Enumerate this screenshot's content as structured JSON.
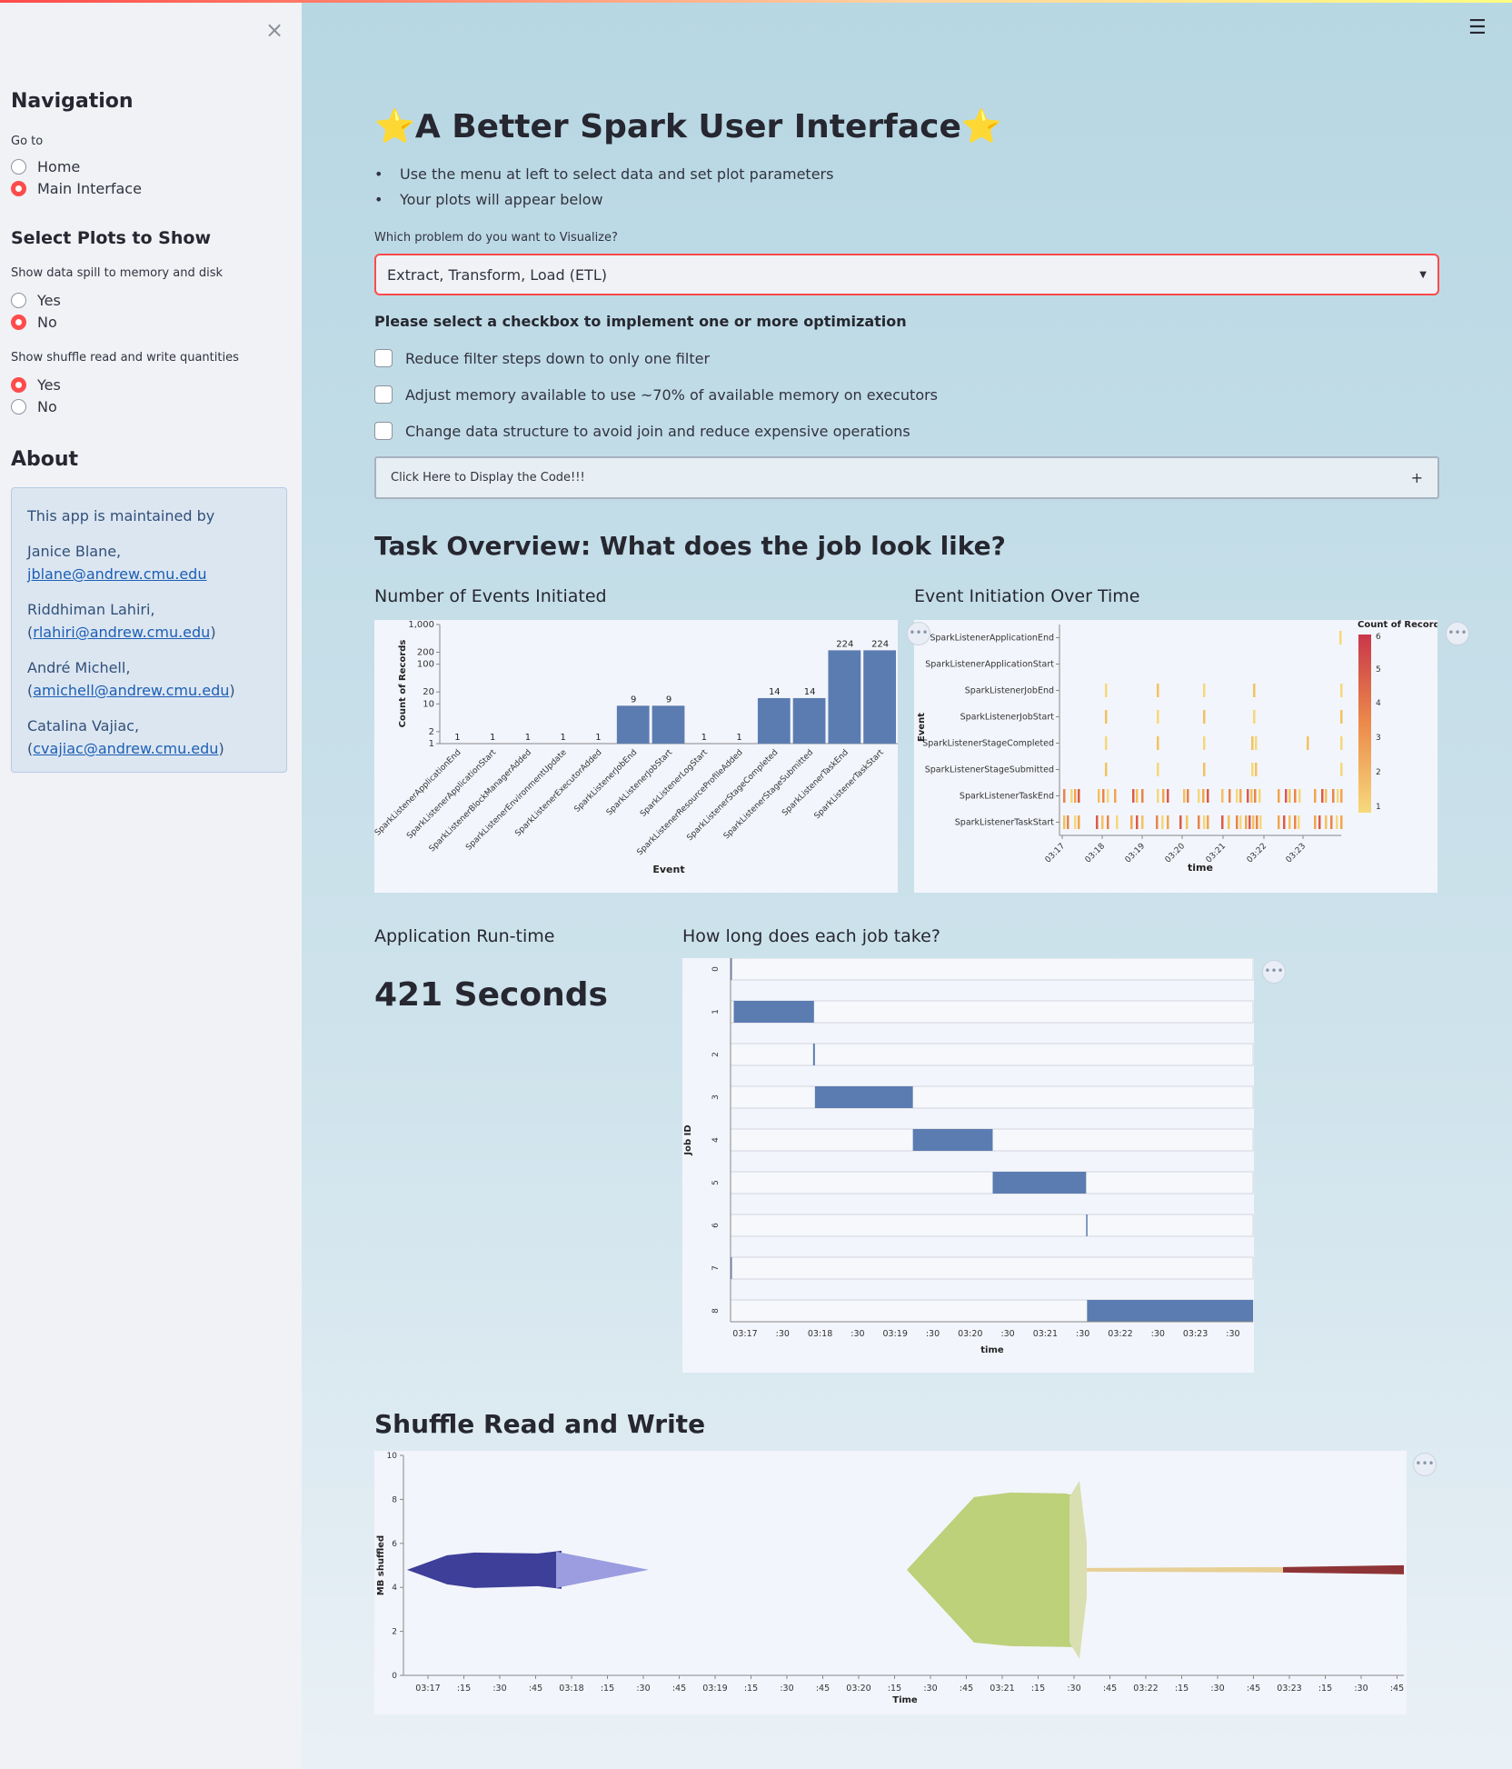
{
  "sidebar": {
    "nav_title": "Navigation",
    "go_to_label": "Go to",
    "nav_options": [
      {
        "label": "Home",
        "selected": false
      },
      {
        "label": "Main Interface",
        "selected": true
      }
    ],
    "plots_title": "Select Plots to Show",
    "spill_label": "Show data spill to memory and disk",
    "spill_options": [
      {
        "label": "Yes",
        "selected": false
      },
      {
        "label": "No",
        "selected": true
      }
    ],
    "shuffle_label": "Show shuffle read and write quantities",
    "shuffle_options": [
      {
        "label": "Yes",
        "selected": true
      },
      {
        "label": "No",
        "selected": false
      }
    ],
    "about_title": "About",
    "about_intro": "This app is maintained by",
    "maintainers": [
      {
        "name": "Janice Blane,",
        "pre": "",
        "email": "jblane@andrew.cmu.edu",
        "post": ""
      },
      {
        "name": "Riddhiman Lahiri,",
        "pre": "(",
        "email": "rlahiri@andrew.cmu.edu",
        "post": ")"
      },
      {
        "name": "André Michell,",
        "pre": "(",
        "email": "amichell@andrew.cmu.edu",
        "post": ")"
      },
      {
        "name": "Catalina Vajiac,",
        "pre": "(",
        "email": "cvajiac@andrew.cmu.edu",
        "post": ")"
      }
    ]
  },
  "main": {
    "title": "⭐A Better Spark User Interface⭐",
    "bullets": [
      "Use the menu at left to select data and set plot parameters",
      "Your plots will appear below"
    ],
    "problem_label": "Which problem do you want to Visualize?",
    "problem_value": "Extract, Transform, Load (ETL)",
    "optim_label": "Please select a checkbox to implement one or more optimization",
    "checkboxes": [
      "Reduce filter steps down to only one filter",
      "Adjust memory available to use ~70% of available memory on executors",
      "Change data structure to avoid join and reduce expensive operations"
    ],
    "expander_label": "Click Here to Display the Code!!!",
    "expander_icon": "+",
    "task_overview_title": "Task Overview: What does the job look like?",
    "events_title": "Number of Events Initiated",
    "event_time_title": "Event Initiation Over Time",
    "runtime_title": "Application Run-time",
    "runtime_value": "421 Seconds",
    "job_title": "How long does each job take?",
    "shuffle_title": "Shuffle Read and Write"
  },
  "chart_data": [
    {
      "type": "bar",
      "scale": "log",
      "xlabel": "Event",
      "ylabel": "Count of Records",
      "y_ticks": [
        "1,000",
        "200",
        "100",
        "20",
        "10",
        "2",
        "1"
      ],
      "categories": [
        "SparkListenerApplicationEnd",
        "SparkListenerApplicationStart",
        "SparkListenerBlockManagerAdded",
        "SparkListenerEnvironmentUpdate",
        "SparkListenerExecutorAdded",
        "SparkListenerJobEnd",
        "SparkListenerJobStart",
        "SparkListenerLogStart",
        "SparkListenerResourceProfileAdded",
        "SparkListenerStageCompleted",
        "SparkListenerStageSubmitted",
        "SparkListenerTaskEnd",
        "SparkListenerTaskStart"
      ],
      "values": [
        1,
        1,
        1,
        1,
        1,
        9,
        9,
        1,
        1,
        14,
        14,
        224,
        224
      ],
      "color": "#5b7cb0"
    },
    {
      "type": "heatmap",
      "xlabel": "time",
      "ylabel": "Event",
      "legend_title": "Count of Records",
      "legend_ticks": [
        "6",
        "5",
        "4",
        "3",
        "2",
        "1"
      ],
      "events": [
        "SparkListenerApplicationEnd",
        "SparkListenerApplicationStart",
        "SparkListenerJobEnd",
        "SparkListenerJobStart",
        "SparkListenerStageCompleted",
        "SparkListenerStageSubmitted",
        "SparkListenerTaskEnd",
        "SparkListenerTaskStart"
      ],
      "time_ticks": [
        "03:17",
        "03:18",
        "03:19",
        "03:20",
        "03:21",
        "03:22",
        "03:23"
      ]
    },
    {
      "type": "gantt",
      "xlabel": "time",
      "ylabel": "Job ID",
      "jobs": [
        "0",
        "1",
        "2",
        "3",
        "4",
        "5",
        "6",
        "7",
        "8"
      ],
      "x_ticks": [
        "03:17",
        ":30",
        "03:18",
        ":30",
        "03:19",
        ":30",
        "03:20",
        ":30",
        "03:21",
        ":30",
        "03:22",
        ":30",
        "03:23",
        ":30"
      ],
      "spans": [
        [
          0,
          1.2
        ],
        [
          3.5,
          92
        ],
        [
          91,
          93
        ],
        [
          93,
          201
        ],
        [
          201,
          289
        ],
        [
          289,
          392
        ],
        [
          392,
          392.5
        ],
        [
          0,
          0.2
        ],
        [
          393,
          576
        ]
      ],
      "color": "#5b7cb0"
    },
    {
      "type": "area",
      "xlabel": "Time",
      "ylabel": "MB shuffled",
      "ylim": [
        0,
        10
      ],
      "y_ticks": [
        "0",
        "2",
        "4",
        "6",
        "8",
        "10"
      ],
      "x_ticks": [
        "03:17",
        ":15",
        ":30",
        ":45",
        "03:18",
        ":15",
        ":30",
        ":45",
        "03:19",
        ":15",
        ":30",
        ":45",
        "03:20",
        ":15",
        ":30",
        ":45",
        "03:21",
        ":15",
        ":30",
        ":45",
        "03:22",
        ":15",
        ":30",
        ":45",
        "03:23",
        ":15",
        ":30",
        ":45"
      ],
      "colors": [
        "#3e3f99",
        "#9b9de0",
        "#bdd07a",
        "#d9dfb0",
        "#e7cf95",
        "#8e3437"
      ]
    }
  ]
}
